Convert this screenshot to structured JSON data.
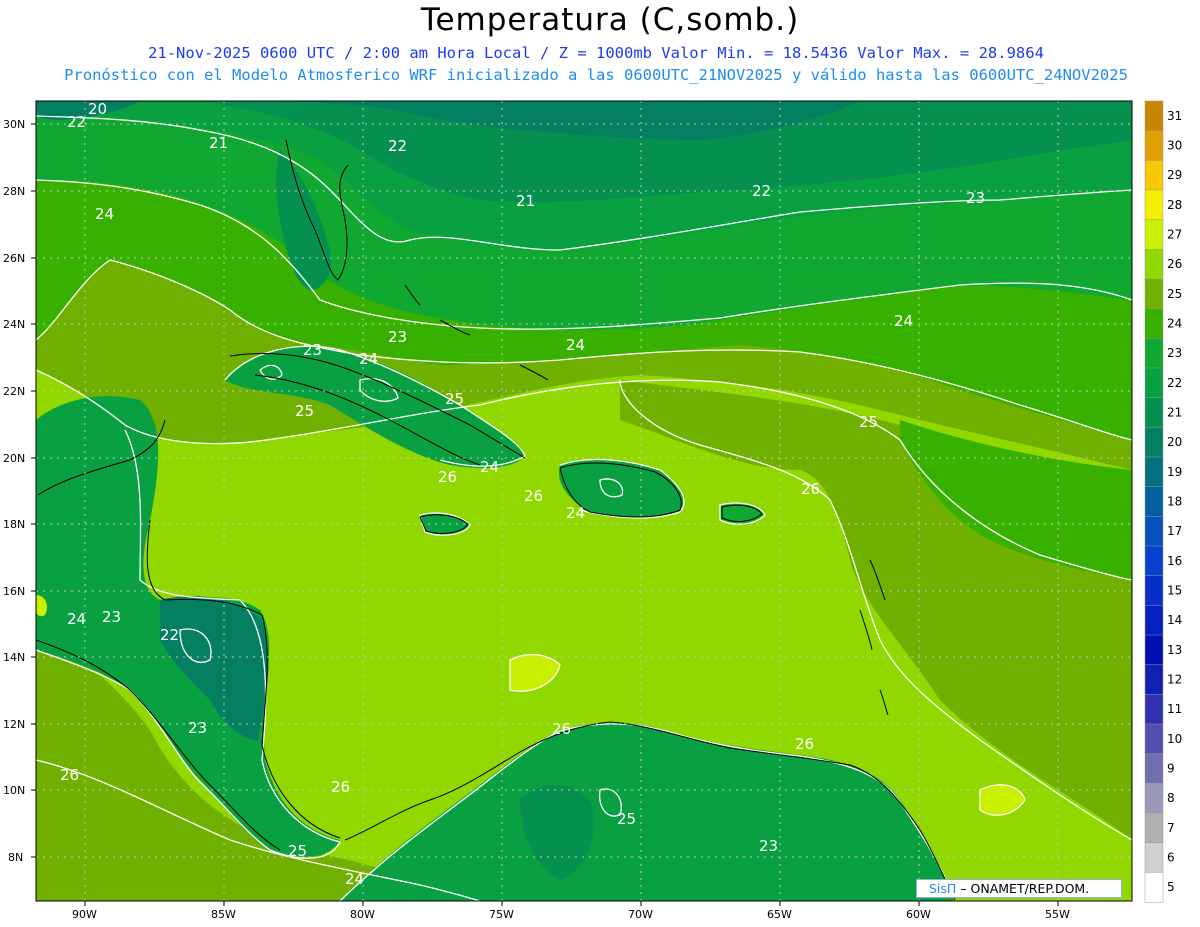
{
  "title": "Temperatura (C,somb.)",
  "subtitle_1": "21-Nov-2025  0600 UTC / 2:00 am Hora Local / Z = 1000mb   Valor Min. = 18.5436  Valor Max. = 28.9864",
  "subtitle_2": "Pronóstico con el Modelo Atmosferico WRF inicializado a las 0600UTC_21NOV2025 y válido hasta las  0600UTC_24NOV2025",
  "credit": {
    "brand": "SisΠ",
    "org": "– ONAMET/REP.DOM."
  },
  "lat_labels": [
    "30N",
    "28N",
    "26N",
    "24N",
    "22N",
    "20N",
    "18N",
    "16N",
    "14N",
    "12N",
    "10N",
    "8N"
  ],
  "lon_labels": [
    "90W",
    "85W",
    "80W",
    "75W",
    "70W",
    "65W",
    "60W",
    "55W"
  ],
  "colorbar": {
    "labels": [
      "31",
      "30",
      "29",
      "28",
      "27",
      "26",
      "25",
      "24",
      "23",
      "22",
      "21",
      "20",
      "19",
      "18",
      "17",
      "16",
      "15",
      "14",
      "13",
      "12",
      "11",
      "10",
      "9",
      "8",
      "7",
      "6",
      "5"
    ],
    "colors": [
      "#c88600",
      "#e0a000",
      "#f8c800",
      "#f4f000",
      "#c8f000",
      "#90d800",
      "#70b000",
      "#38b000",
      "#10a830",
      "#08a040",
      "#069050",
      "#048060",
      "#047080",
      "#0460a0",
      "#0850c0",
      "#0840d0",
      "#0830c8",
      "#0420c0",
      "#0010b0",
      "#1020b0",
      "#3030b0",
      "#5050b0",
      "#7070b0",
      "#9a9ab8",
      "#b0b0b0",
      "#d0d0d0",
      "#ffffff"
    ]
  },
  "contour_labels": [
    {
      "t": "20"
    },
    {
      "t": "22"
    },
    {
      "t": "21"
    },
    {
      "t": "22"
    },
    {
      "t": "21"
    },
    {
      "t": "22"
    },
    {
      "t": "23"
    },
    {
      "t": "24"
    },
    {
      "t": "23"
    },
    {
      "t": "24"
    },
    {
      "t": "24"
    },
    {
      "t": "24"
    },
    {
      "t": "23"
    },
    {
      "t": "25"
    },
    {
      "t": "25"
    },
    {
      "t": "26"
    },
    {
      "t": "24"
    },
    {
      "t": "25"
    },
    {
      "t": "26"
    },
    {
      "t": "24"
    },
    {
      "t": "26"
    },
    {
      "t": "24"
    },
    {
      "t": "23"
    },
    {
      "t": "22"
    },
    {
      "t": "23"
    },
    {
      "t": "26"
    },
    {
      "t": "26"
    },
    {
      "t": "25"
    },
    {
      "t": "24"
    },
    {
      "t": "26"
    },
    {
      "t": "23"
    },
    {
      "t": "26"
    },
    {
      "t": "25"
    }
  ]
}
